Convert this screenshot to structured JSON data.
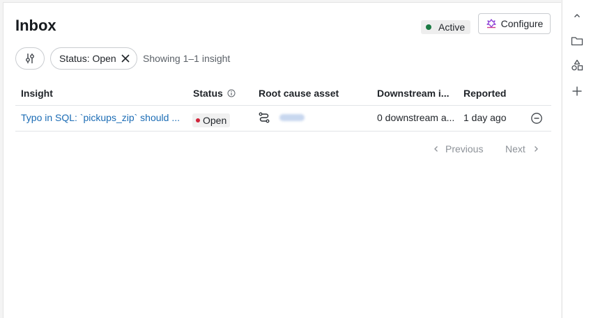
{
  "header": {
    "title": "Inbox",
    "status_label": "Active",
    "status_color": "#1a7a43",
    "configure_label": "Configure"
  },
  "filters": {
    "filter_icon": "sliders-icon",
    "chip_label": "Status: Open",
    "showing_text": "Showing 1–1 insight"
  },
  "table": {
    "columns": {
      "insight": "Insight",
      "status": "Status",
      "root_cause": "Root cause asset",
      "downstream": "Downstream i...",
      "reported": "Reported"
    },
    "rows": [
      {
        "insight": "Typo in SQL: `pickups_zip` should ...",
        "status": "Open",
        "status_color": "#d0243a",
        "root_cause_icon": "job-icon",
        "downstream": "0 downstream a...",
        "reported": "1 day ago"
      }
    ]
  },
  "pagination": {
    "previous_label": "Previous",
    "next_label": "Next"
  },
  "rail": {
    "icons": [
      "chevron-up-icon",
      "folder-icon",
      "shapes-icon",
      "plus-icon"
    ]
  }
}
